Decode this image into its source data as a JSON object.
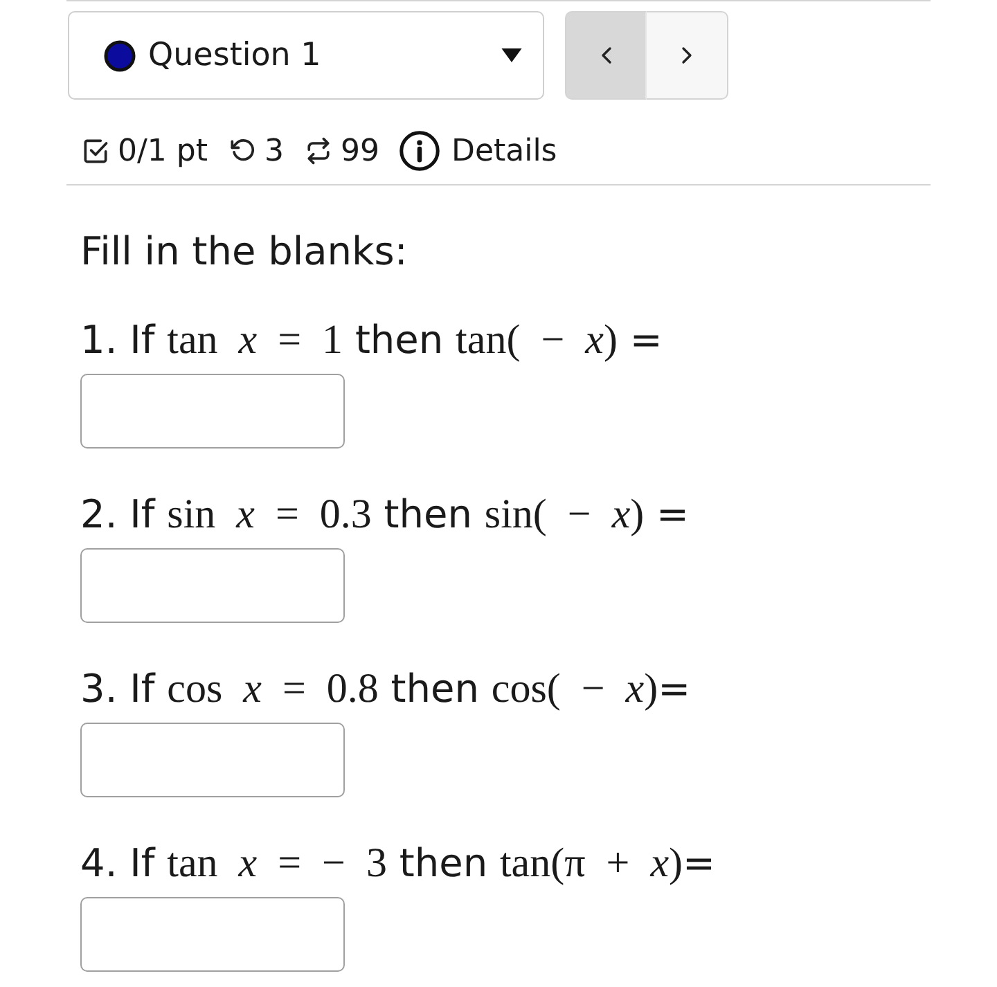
{
  "question_selector": {
    "label": "Question 1"
  },
  "nav_buttons": [
    {
      "kind": "previous",
      "disabled": true
    },
    {
      "kind": "next",
      "disabled": false
    }
  ],
  "score_bar": {
    "points": "0/1 pt",
    "attempts": "3",
    "versions": "99",
    "details_link": "Details"
  },
  "instructions": "Fill in the blanks:",
  "questions": [
    {
      "parts": [
        {
          "kind": "text",
          "text": "1. If "
        },
        {
          "kind": "math",
          "text": "tan *x* = 1"
        },
        {
          "kind": "text",
          "text": " then "
        },
        {
          "kind": "math",
          "text": "tan( − *x*)"
        },
        {
          "kind": "text",
          "text": " ="
        }
      ]
    },
    {
      "parts": [
        {
          "kind": "text",
          "text": "2. If "
        },
        {
          "kind": "math",
          "text": "sin *x* = 0.3"
        },
        {
          "kind": "text",
          "text": " then "
        },
        {
          "kind": "math",
          "text": "sin( − *x*)"
        },
        {
          "kind": "text",
          "text": " ="
        }
      ]
    },
    {
      "parts": [
        {
          "kind": "text",
          "text": "3. If "
        },
        {
          "kind": "math",
          "text": "cos *x* = 0.8"
        },
        {
          "kind": "text",
          "text": " then "
        },
        {
          "kind": "math",
          "text": "cos( − *x*)"
        },
        {
          "kind": "text",
          "text": "="
        }
      ]
    },
    {
      "parts": [
        {
          "kind": "text",
          "text": "4. If "
        },
        {
          "kind": "math",
          "text": "tan *x* = − 3"
        },
        {
          "kind": "text",
          "text": " then "
        },
        {
          "kind": "math",
          "text": "tan(π + *x*)"
        },
        {
          "kind": "text",
          "text": "="
        }
      ]
    }
  ]
}
